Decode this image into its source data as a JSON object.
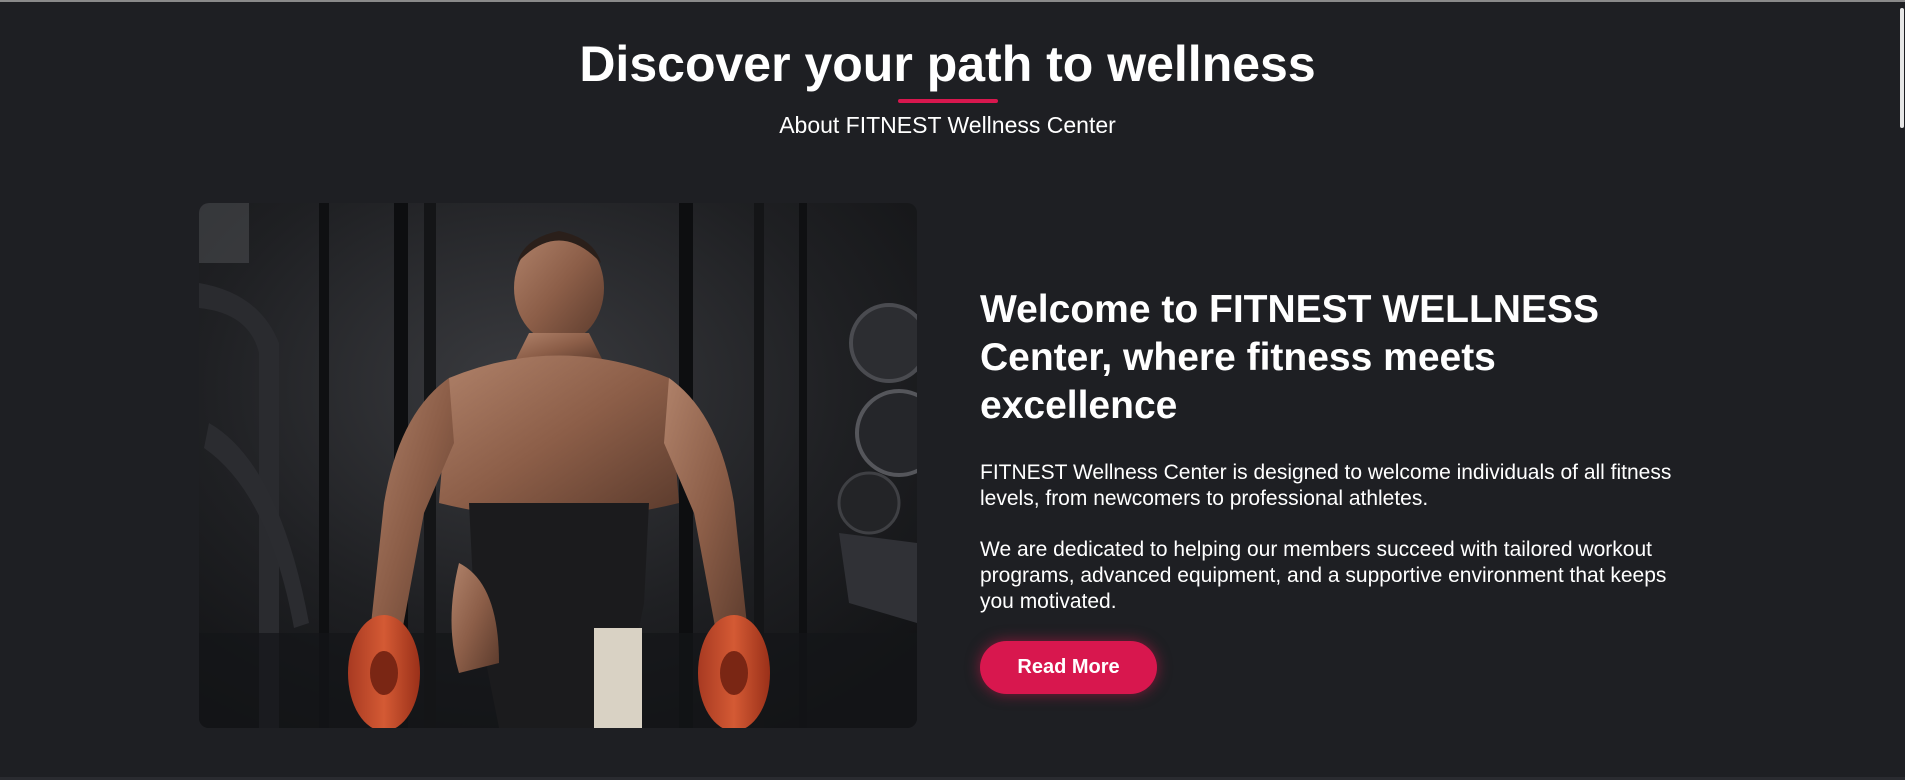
{
  "section": {
    "title": "Discover your path to wellness",
    "subtitle": "About FITNEST Wellness Center"
  },
  "about": {
    "heading": "Welcome to FITNEST WELLNESS Center, where fitness meets excellence",
    "paragraph_1": "FITNEST Wellness Center is designed to welcome individuals of all fitness levels, from newcomers to professional athletes.",
    "paragraph_2": "We are dedicated to helping our members succeed with tailored workout programs, advanced equipment, and a supportive environment that keeps you motivated.",
    "button_label": "Read More"
  },
  "colors": {
    "background": "#1e1f23",
    "accent": "#d8174e",
    "text": "#ffffff"
  }
}
